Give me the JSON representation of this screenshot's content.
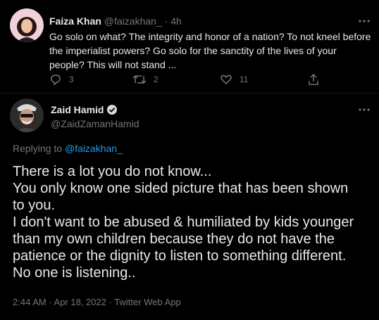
{
  "parent_tweet": {
    "author_name": "Faiza Khan",
    "author_handle": "@faizakhan_",
    "separator": "·",
    "time": "4h",
    "text": "Go solo on what? The integrity and honor of a nation? To not kneel before the imperialist powers? Go solo for the sanctity of the lives of your people? This will not stand ...",
    "reply_count": "3",
    "retweet_count": "2",
    "like_count": "11",
    "icons": [
      "reply-icon",
      "retweet-icon",
      "like-icon",
      "share-icon",
      "more-icon"
    ]
  },
  "main_tweet": {
    "author_name": "Zaid Hamid",
    "author_handle": "@ZaidZamanHamid",
    "verified": true,
    "replying_prefix": "Replying to ",
    "replying_to": "@faizakhan_",
    "text_lines": [
      "There is a lot you do not know...",
      "You only know one sided picture that has been shown",
      "to you.",
      "I don't want to be abused & humiliated by kids younger",
      "than my own children because they do not have the",
      "patience or the dignity to listen to something different.",
      "No one is listening.."
    ],
    "meta": "2:44 AM · Apr 18, 2022 · Twitter Web App"
  },
  "colors": {
    "background": "#000000",
    "text": "#e7e9ea",
    "secondary": "#71767b",
    "accent": "#1d9bf0"
  }
}
